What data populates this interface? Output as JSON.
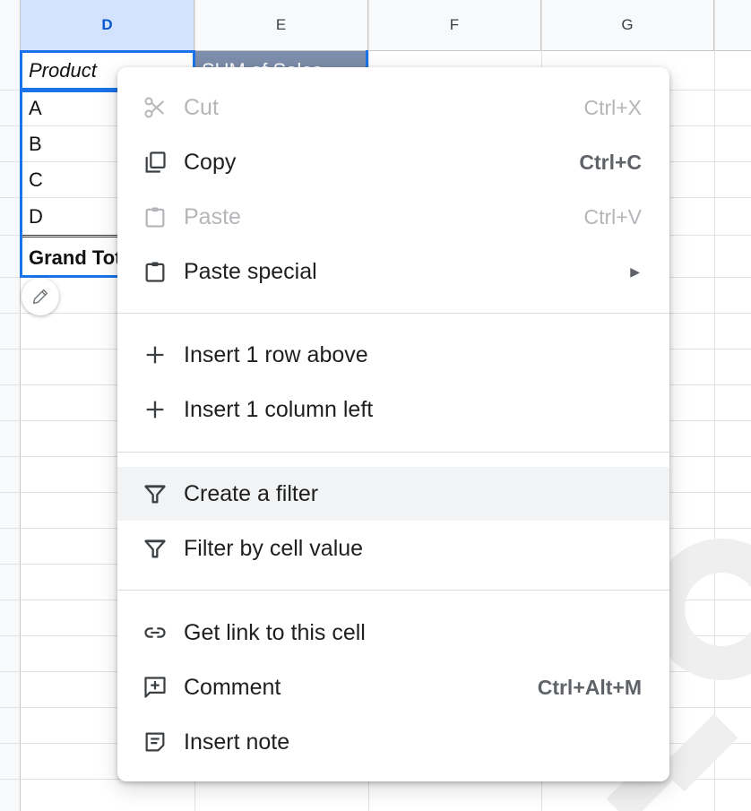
{
  "sheet": {
    "columns": [
      "D",
      "E",
      "F",
      "G"
    ],
    "selected_column": "D",
    "pivot_header": {
      "product": "Product",
      "sum": "SUM of Sales"
    },
    "rows": [
      "A",
      "B",
      "C",
      "D"
    ],
    "grand_total": "Grand Total"
  },
  "menu": {
    "items": [
      {
        "label": "Cut",
        "shortcut": "Ctrl+X",
        "icon": "scissors-icon",
        "disabled": true
      },
      {
        "label": "Copy",
        "shortcut": "Ctrl+C",
        "icon": "copy-icon",
        "disabled": false
      },
      {
        "label": "Paste",
        "shortcut": "Ctrl+V",
        "icon": "clipboard-icon",
        "disabled": true
      },
      {
        "label": "Paste special",
        "icon": "clipboard-icon",
        "submenu_arrow": "▶"
      },
      {
        "label": "Insert 1 row above",
        "icon": "plus-icon"
      },
      {
        "label": "Insert 1 column left",
        "icon": "plus-icon"
      },
      {
        "label": "Create a filter",
        "icon": "filter-icon",
        "highlighted": true
      },
      {
        "label": "Filter by cell value",
        "icon": "filter-icon"
      },
      {
        "label": "Get link to this cell",
        "icon": "link-icon"
      },
      {
        "label": "Comment",
        "shortcut": "Ctrl+Alt+M",
        "icon": "comment-add-icon"
      },
      {
        "label": "Insert note",
        "icon": "note-icon"
      }
    ]
  },
  "colors": {
    "selection": "#1a73e8",
    "pivot_header_bg": "#7c8eab",
    "menu_hover": "#f1f3f4"
  }
}
